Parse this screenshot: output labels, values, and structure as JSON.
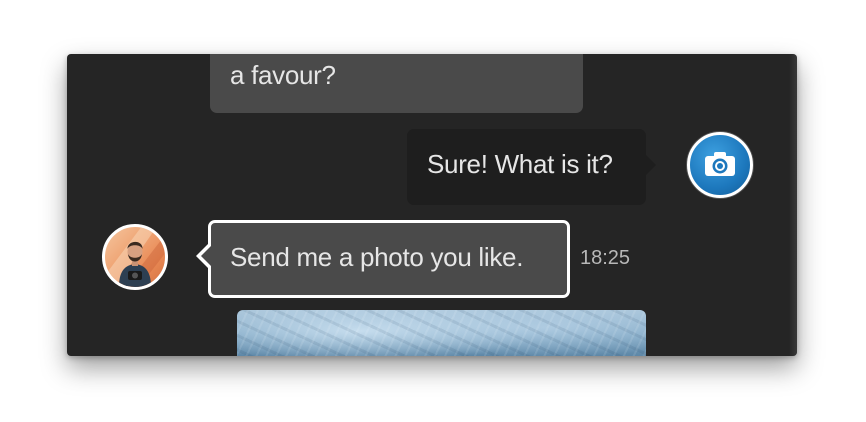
{
  "conversation": {
    "messages": [
      {
        "id": "partial",
        "text": "a favour?"
      },
      {
        "id": "reply",
        "text": "Sure! What is it?"
      },
      {
        "id": "request",
        "text": "Send me a photo you like.",
        "time": "18:25"
      }
    ],
    "avatars": {
      "self_icon": "camera-icon",
      "self_color": "#1d78bd",
      "contact_icon": "person-photo"
    },
    "colors": {
      "window_bg": "#252525",
      "bubble_incoming": "#4a4a4a",
      "bubble_outgoing": "#1e1e1e",
      "selection_border": "#ffffff"
    }
  }
}
